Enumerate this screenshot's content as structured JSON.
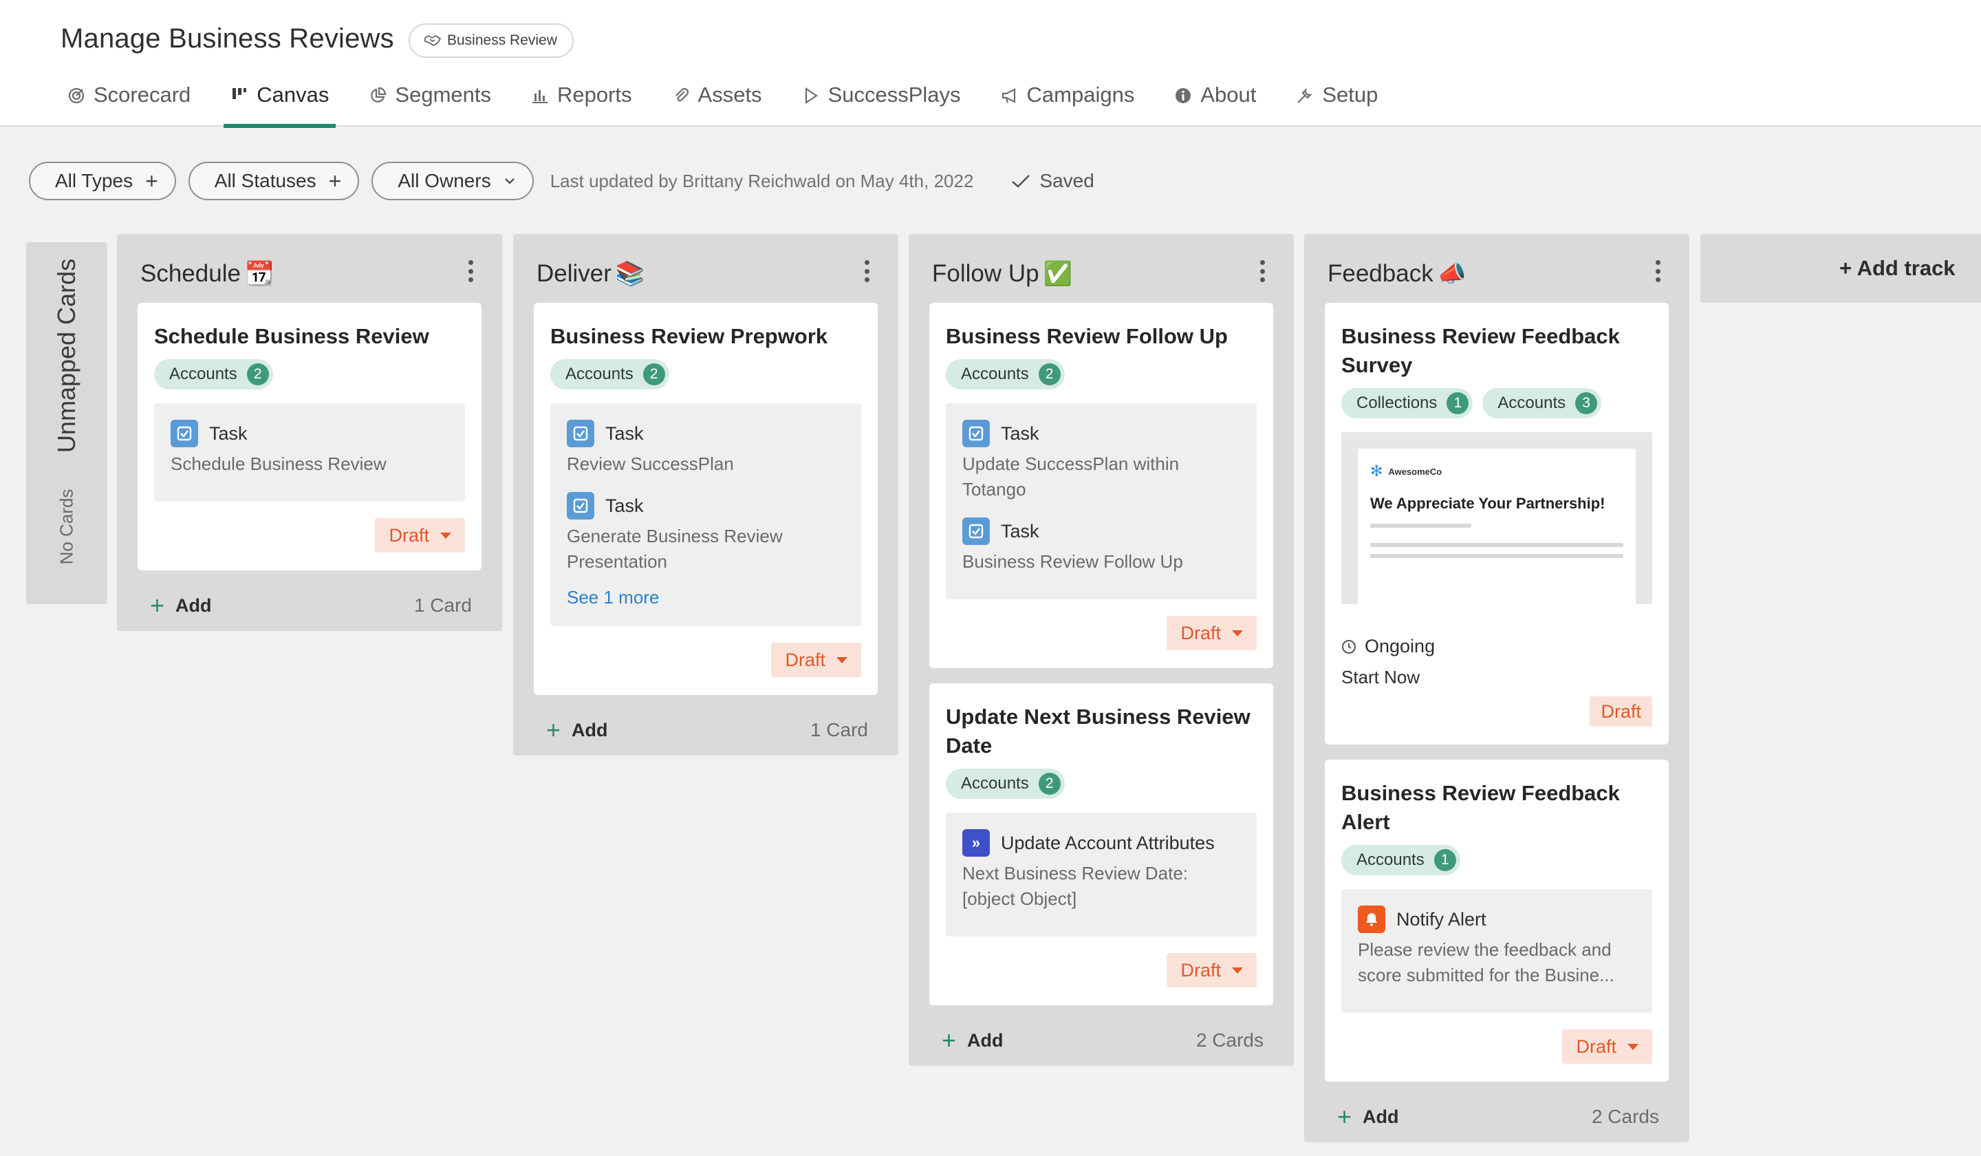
{
  "header": {
    "title": "Manage Business Reviews",
    "badge": "Business Review",
    "tabs": [
      {
        "label": "Scorecard",
        "icon": "target-icon"
      },
      {
        "label": "Canvas",
        "icon": "canvas-icon"
      },
      {
        "label": "Segments",
        "icon": "pie-chart-icon"
      },
      {
        "label": "Reports",
        "icon": "bar-chart-icon"
      },
      {
        "label": "Assets",
        "icon": "paperclip-icon"
      },
      {
        "label": "SuccessPlays",
        "icon": "play-icon"
      },
      {
        "label": "Campaigns",
        "icon": "megaphone-icon"
      },
      {
        "label": "About",
        "icon": "info-icon"
      },
      {
        "label": "Setup",
        "icon": "wrench-icon"
      }
    ],
    "active_tab": "Canvas"
  },
  "filters": {
    "types": "All Types",
    "statuses": "All Statuses",
    "owners": "All Owners",
    "last_updated": "Last updated by Brittany Reichwald on May 4th, 2022",
    "saved": "Saved"
  },
  "unmapped": {
    "title": "Unmapped Cards",
    "count": "No Cards"
  },
  "colors": {
    "accent": "#1f8a70",
    "tag_bg": "#d6ebe3",
    "tag_count": "#3f9a79",
    "draft_bg": "#fbe2d8",
    "draft_text": "#e0592a",
    "task_icon": "#5b9bd5"
  },
  "tracks": [
    {
      "name": "Schedule",
      "emoji": "📆",
      "cards": [
        {
          "title": "Schedule Business Review",
          "tags": [
            {
              "label": "Accounts",
              "count": "2"
            }
          ],
          "steps": [
            {
              "type": "Task",
              "desc": "Schedule Business Review"
            }
          ],
          "status": "Draft"
        }
      ],
      "add": "Add",
      "count": "1 Card"
    },
    {
      "name": "Deliver",
      "emoji": "📚",
      "cards": [
        {
          "title": "Business Review Prepwork",
          "tags": [
            {
              "label": "Accounts",
              "count": "2"
            }
          ],
          "steps": [
            {
              "type": "Task",
              "desc": "Review SuccessPlan"
            },
            {
              "type": "Task",
              "desc": "Generate Business Review Presentation"
            }
          ],
          "see_more": "See 1 more",
          "status": "Draft"
        }
      ],
      "add": "Add",
      "count": "1 Card"
    },
    {
      "name": "Follow Up",
      "emoji": "✅",
      "cards": [
        {
          "title": "Business Review Follow Up",
          "tags": [
            {
              "label": "Accounts",
              "count": "2"
            }
          ],
          "steps": [
            {
              "type": "Task",
              "desc": "Update SuccessPlan within Totango"
            },
            {
              "type": "Task",
              "desc": "Business Review Follow Up"
            }
          ],
          "status": "Draft"
        },
        {
          "title": "Update Next Business Review Date",
          "tags": [
            {
              "label": "Accounts",
              "count": "2"
            }
          ],
          "steps": [
            {
              "type": "Update Account Attributes",
              "desc": "Next Business Review Date: [object Object]"
            }
          ],
          "status": "Draft"
        }
      ],
      "add": "Add",
      "count": "2 Cards"
    },
    {
      "name": "Feedback",
      "emoji": "📣",
      "cards": [
        {
          "title": "Business Review Feedback Survey",
          "tags": [
            {
              "label": "Collections",
              "count": "1"
            },
            {
              "label": "Accounts",
              "count": "3"
            }
          ],
          "preview": {
            "logo": "AwesomeCo",
            "headline": "We Appreciate Your Partnership!"
          },
          "schedule": "Ongoing",
          "start": "Start Now",
          "status": "Draft"
        },
        {
          "title": "Business Review Feedback Alert",
          "tags": [
            {
              "label": "Accounts",
              "count": "1"
            }
          ],
          "steps": [
            {
              "type": "Notify Alert",
              "desc": "Please review the feedback and score submitted for the Busine..."
            }
          ],
          "status": "Draft"
        }
      ],
      "add": "Add",
      "count": "2 Cards"
    }
  ],
  "add_track": "+ Add track"
}
